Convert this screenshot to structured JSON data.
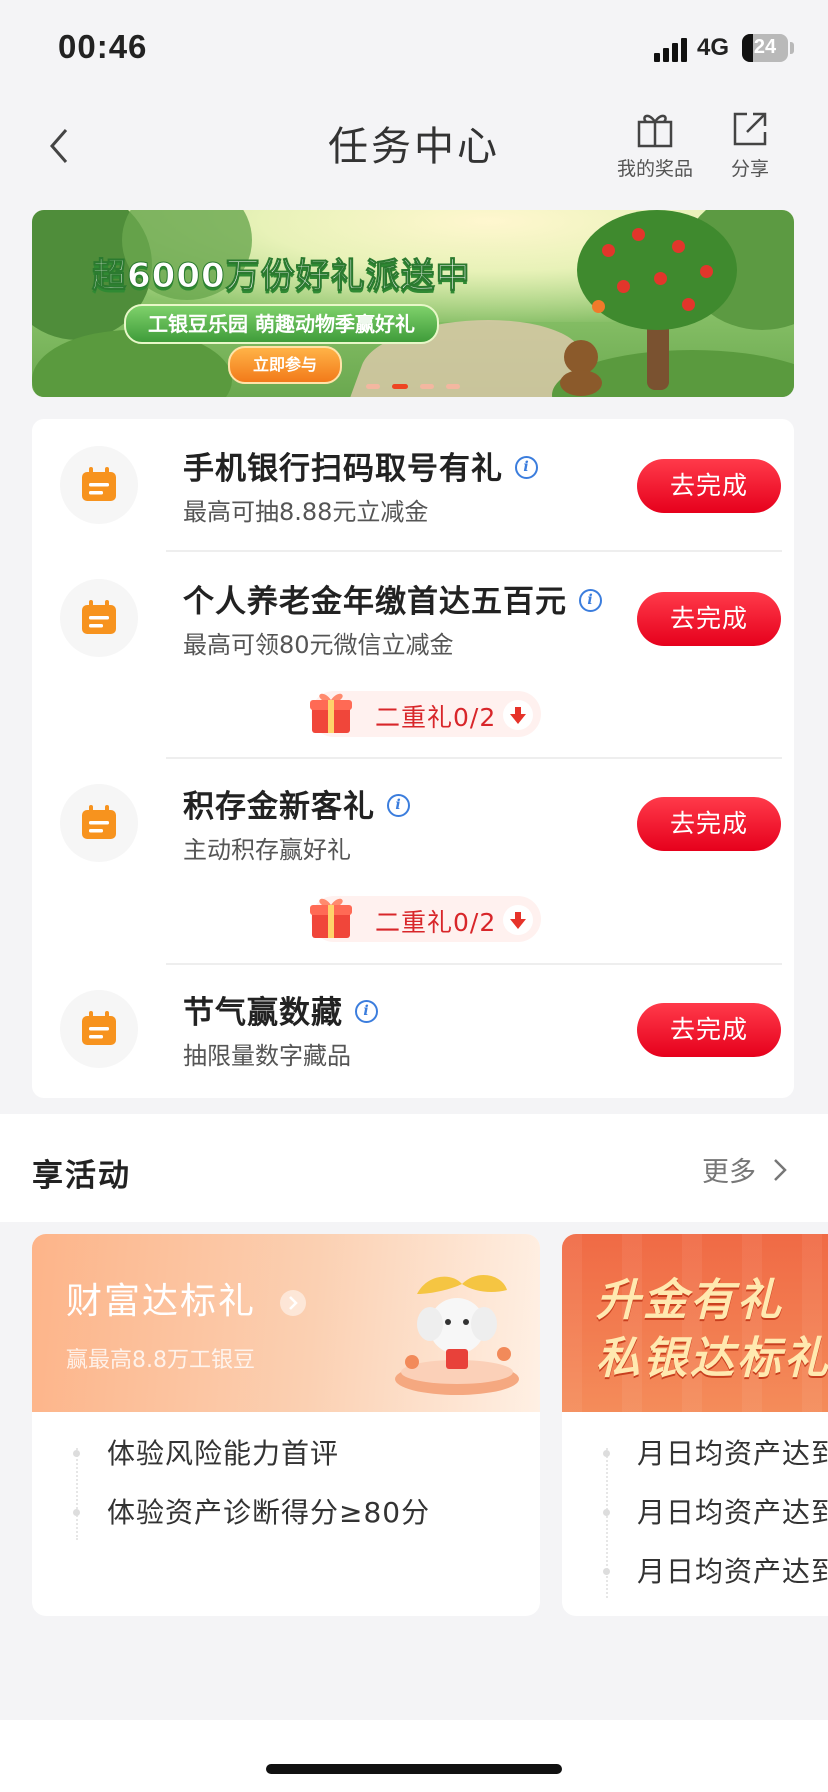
{
  "status_bar": {
    "time": "00:46",
    "network": "4G",
    "battery": "24"
  },
  "header": {
    "title": "任务中心",
    "prizes_label": "我的奖品",
    "share_label": "分享"
  },
  "banner": {
    "headline": "超6000万份好礼派送中",
    "subline": "工银豆乐园 萌趣动物季赢好礼",
    "cta": "立即参与",
    "active_slide": 2,
    "slide_count": 4
  },
  "tasks": [
    {
      "name": "手机银行扫码取号有礼",
      "desc": "最高可抽8.88元立减金",
      "action": "去完成"
    },
    {
      "name": "个人养老金年缴首达五百元",
      "desc": "最高可领80元微信立减金",
      "action": "去完成",
      "bonus": "二重礼0/2"
    },
    {
      "name": "积存金新客礼",
      "desc": "主动积存赢好礼",
      "action": "去完成",
      "bonus": "二重礼0/2"
    },
    {
      "name": "节气赢数藏",
      "desc": "抽限量数字藏品",
      "action": "去完成"
    }
  ],
  "activities": {
    "title": "享活动",
    "more": "更多",
    "cards": [
      {
        "title": "财富达标礼",
        "subtitle": "赢最高8.8万工银豆",
        "items": [
          "体验风险能力首评",
          "体验资产诊断得分≥80分"
        ]
      },
      {
        "title_line1": "升金有礼",
        "title_line2": "私银达标礼",
        "items": [
          "月日均资产达到",
          "月日均资产达到",
          "月日均资产达到"
        ]
      }
    ]
  },
  "colors": {
    "accent": "#e6001c",
    "icon": "#f7931e",
    "link": "#3b7ddd"
  }
}
